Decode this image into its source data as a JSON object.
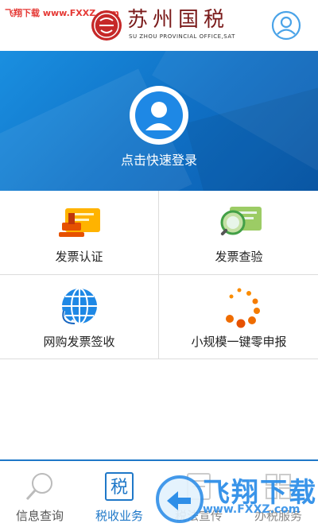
{
  "watermark_top": "飞翔下载 www.FXXZ.com",
  "header": {
    "logo_title": "苏州国税",
    "logo_subtitle": "SU ZHOU PROVINCIAL OFFICE,SAT",
    "avatar_icon": "user-profile-icon"
  },
  "hero": {
    "login_label": "点击快速登录",
    "login_icon": "user-avatar-icon"
  },
  "grid": [
    {
      "label": "发票认证",
      "icon": "invoice-certify-icon"
    },
    {
      "label": "发票查验",
      "icon": "invoice-check-icon"
    },
    {
      "label": "网购发票签收",
      "icon": "online-invoice-icon"
    },
    {
      "label": "小规模一键零申报",
      "icon": "loading-dots-icon"
    }
  ],
  "bottom_nav": [
    {
      "label": "信息查询",
      "icon": "search-icon"
    },
    {
      "label": "税收业务",
      "icon": "tax-icon",
      "glyph": "税"
    },
    {
      "label": "税法宣传",
      "icon": "doc-icon"
    },
    {
      "label": "办税服务",
      "icon": "service-icon"
    }
  ],
  "watermark_bottom": {
    "text": "飞翔下载",
    "url": "www.FXXZ.com"
  },
  "colors": {
    "primary": "#1f78c8",
    "hero": "#0f6fc4",
    "brand_red": "#b71c1c"
  }
}
